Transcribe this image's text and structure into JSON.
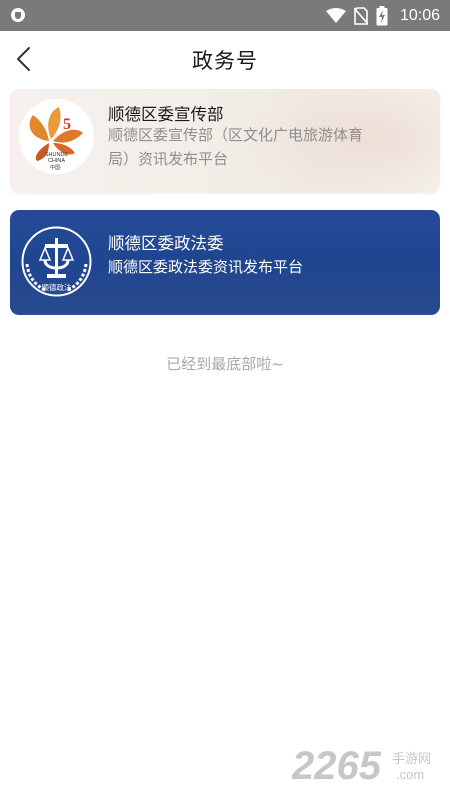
{
  "status_bar": {
    "time": "10:06",
    "icons": [
      "shield-icon",
      "wifi-icon",
      "no-sim-icon",
      "battery-charging-icon"
    ]
  },
  "header": {
    "title": "政务号",
    "back_icon": "chevron-left-icon"
  },
  "accounts": [
    {
      "name": "顺德区委宣传部",
      "description": "顺德区委宣传部（区文化广电旅游体育局）资讯发布平台",
      "logo_text": "SHUNDE CHINA 中国·"
    },
    {
      "name": "顺德区委政法委",
      "description": "顺德区委政法委资讯发布平台",
      "logo_text": "顺德政法"
    }
  ],
  "end_tip": "已经到最底部啦~",
  "watermark": {
    "number": "2265",
    "suffix": "手游网",
    "domain": ".com"
  },
  "colors": {
    "status_bar": "#7a7a7a",
    "card_blue": "#224793",
    "text_gray": "#8e8e8e",
    "watermark_gray": "#c7c7c7"
  }
}
